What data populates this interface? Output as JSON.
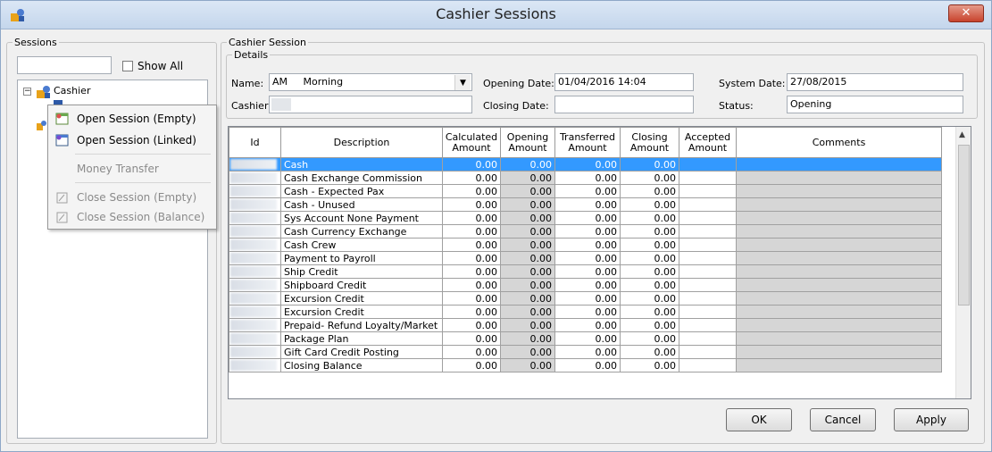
{
  "window": {
    "title": "Cashier Sessions",
    "close_label": "✕"
  },
  "sessions": {
    "legend": "Sessions",
    "search_value": "",
    "show_all_label": "Show All",
    "tree": {
      "root_label": "Cashier"
    },
    "context_menu": {
      "items": [
        {
          "label": "Open Session (Empty)",
          "enabled": true
        },
        {
          "label": "Open Session (Linked)",
          "enabled": true
        },
        {
          "label": "Money Transfer",
          "enabled": false
        },
        {
          "label": "Close Session (Empty)",
          "enabled": false
        },
        {
          "label": "Close Session (Balance)",
          "enabled": false
        }
      ]
    }
  },
  "cashier_session": {
    "legend": "Cashier Session",
    "details": {
      "legend": "Details",
      "name_label": "Name:",
      "name_code": "AM",
      "name_value": "Morning",
      "cashier_label": "Cashier:",
      "opening_date_label": "Opening Date:",
      "opening_date_value": "01/04/2016 14:04",
      "closing_date_label": "Closing Date:",
      "closing_date_value": "",
      "system_date_label": "System Date:",
      "system_date_value": "27/08/2015",
      "status_label": "Status:",
      "status_value": "Opening"
    }
  },
  "grid": {
    "columns": [
      "Id",
      "Description",
      "Calculated Amount",
      "Opening Amount",
      "Transferred Amount",
      "Closing Amount",
      "Accepted Amount",
      "Comments"
    ],
    "rows": [
      {
        "description": "Cash",
        "calculated": "0.00",
        "opening": "0.00",
        "transferred": "0.00",
        "closing": "0.00",
        "selected": true
      },
      {
        "description": "Cash Exchange Commission",
        "calculated": "0.00",
        "opening": "0.00",
        "transferred": "0.00",
        "closing": "0.00"
      },
      {
        "description": "Cash - Expected Pax",
        "calculated": "0.00",
        "opening": "0.00",
        "transferred": "0.00",
        "closing": "0.00"
      },
      {
        "description": "Cash - Unused",
        "calculated": "0.00",
        "opening": "0.00",
        "transferred": "0.00",
        "closing": "0.00"
      },
      {
        "description": "Sys Account None Payment",
        "calculated": "0.00",
        "opening": "0.00",
        "transferred": "0.00",
        "closing": "0.00"
      },
      {
        "description": "Cash Currency Exchange",
        "calculated": "0.00",
        "opening": "0.00",
        "transferred": "0.00",
        "closing": "0.00"
      },
      {
        "description": "Cash Crew",
        "calculated": "0.00",
        "opening": "0.00",
        "transferred": "0.00",
        "closing": "0.00"
      },
      {
        "description": "Payment to Payroll",
        "calculated": "0.00",
        "opening": "0.00",
        "transferred": "0.00",
        "closing": "0.00"
      },
      {
        "description": "Ship Credit",
        "calculated": "0.00",
        "opening": "0.00",
        "transferred": "0.00",
        "closing": "0.00"
      },
      {
        "description": "Shipboard Credit",
        "calculated": "0.00",
        "opening": "0.00",
        "transferred": "0.00",
        "closing": "0.00"
      },
      {
        "description": "Excursion Credit",
        "calculated": "0.00",
        "opening": "0.00",
        "transferred": "0.00",
        "closing": "0.00"
      },
      {
        "description": "Excursion Credit",
        "calculated": "0.00",
        "opening": "0.00",
        "transferred": "0.00",
        "closing": "0.00"
      },
      {
        "description": "Prepaid- Refund Loyalty/Market",
        "calculated": "0.00",
        "opening": "0.00",
        "transferred": "0.00",
        "closing": "0.00"
      },
      {
        "description": "Package Plan",
        "calculated": "0.00",
        "opening": "0.00",
        "transferred": "0.00",
        "closing": "0.00"
      },
      {
        "description": "Gift Card Credit Posting",
        "calculated": "0.00",
        "opening": "0.00",
        "transferred": "0.00",
        "closing": "0.00"
      },
      {
        "description": "Closing Balance",
        "calculated": "0.00",
        "opening": "0.00",
        "transferred": "0.00",
        "closing": "0.00"
      }
    ]
  },
  "buttons": {
    "ok": "OK",
    "cancel": "Cancel",
    "apply": "Apply"
  },
  "colors": {
    "selection": "#3399ff",
    "readonly_cell": "#d6d6d6",
    "title_bg": "#c4d6ec",
    "close_red": "#c8432d"
  },
  "icons": [
    "app-icon",
    "close-icon",
    "cashier-tree-icon",
    "open-session-empty-icon",
    "open-session-linked-icon",
    "close-session-empty-icon",
    "close-session-balance-icon",
    "dropdown-arrow-icon",
    "scroll-up-icon"
  ]
}
